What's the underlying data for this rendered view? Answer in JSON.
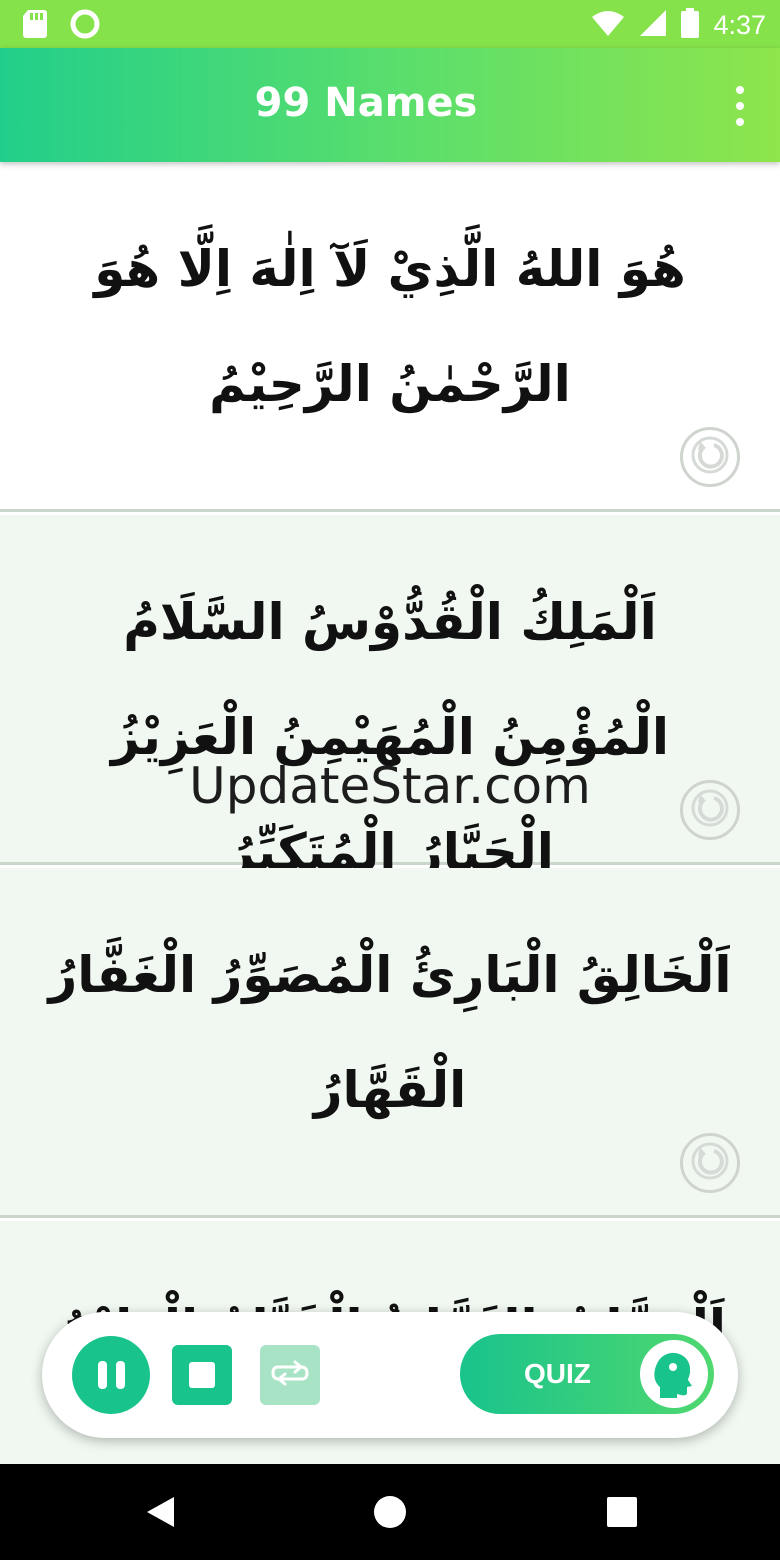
{
  "status_bar": {
    "time": "4:37",
    "icons": [
      "sd-card-icon",
      "sync-circle-icon",
      "wifi-icon",
      "cell-signal-icon",
      "battery-icon"
    ]
  },
  "app_bar": {
    "title": "99 Names",
    "menu_icon": "overflow-menu-icon"
  },
  "names_list": {
    "items": [
      {
        "text": "هُوَ اللهُ الَّذِيْ لَآ اِلٰهَ اِلَّا هُوَ الرَّحْمٰنُ الرَّحِيْمُ"
      },
      {
        "text": "اَلْمَلِكُ الْقُدُّوْسُ السَّلَامُ الْمُؤْمِنُ الْمُهَيْمِنُ الْعَزِيْزُ الْجَبَّارُ الْمُتَكَبِّرُ"
      },
      {
        "text": "اَلْخَالِقُ الْبَارِئُ الْمُصَوِّرُ الْغَفَّارُ الْقَهَّارُ"
      },
      {
        "text": "اَلْوَهَّابُ الرَّزَّاقُ الْفَتَّاحُ الْعَلِيْمُ"
      }
    ],
    "item_icon": "replay-icon"
  },
  "watermark": "UpdateStar.com",
  "player": {
    "pause_icon": "pause-icon",
    "stop_icon": "stop-icon",
    "repeat_icon": "repeat-icon",
    "quiz_label": "QUIZ",
    "quiz_icon": "head-profile-icon"
  },
  "colors": {
    "status_bar": "#86e24a",
    "accent": "#19c38c",
    "accent_light": "#a9e3c5",
    "gradient_start": "#22cf8a",
    "gradient_end": "#8ee54c",
    "card_tint": "#f1f8f1"
  },
  "nav_bar": {
    "icons": [
      "back-triangle-icon",
      "home-circle-icon",
      "recents-square-icon"
    ]
  }
}
